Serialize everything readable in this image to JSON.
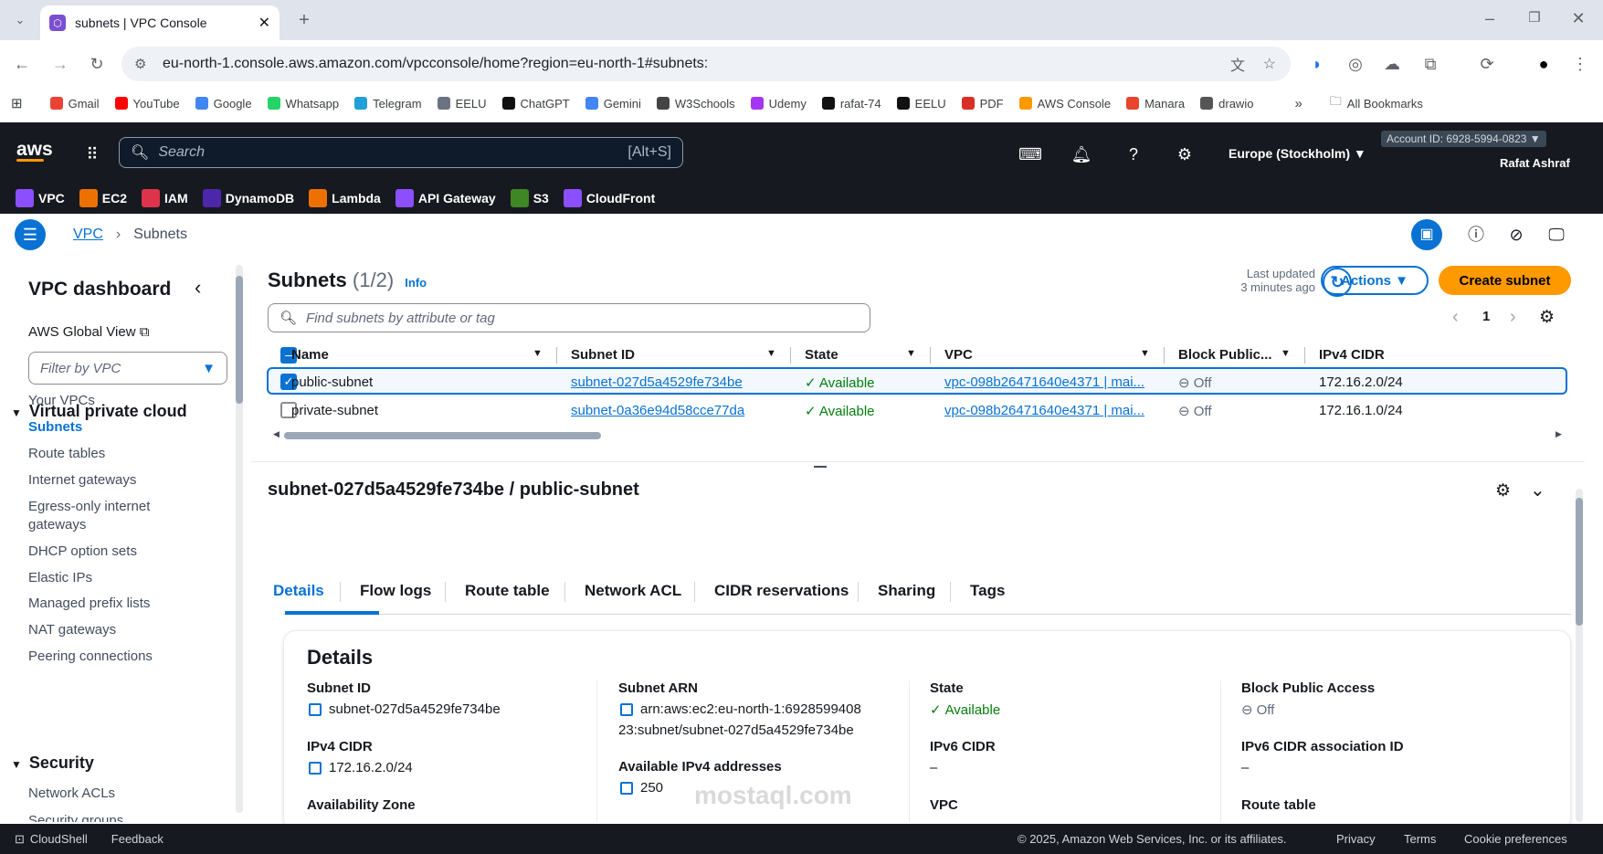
{
  "browser": {
    "tab_title": "subnets | VPC Console",
    "url": "eu-north-1.console.aws.amazon.com/vpcconsole/home?region=eu-north-1#subnets:",
    "bookmarks": [
      "Gmail",
      "YouTube",
      "Google",
      "Whatsapp",
      "Telegram",
      "EELU",
      "ChatGPT",
      "Gemini",
      "W3Schools",
      "Udemy",
      "rafat-74",
      "EELU",
      "PDF",
      "AWS Console",
      "Manara",
      "drawio"
    ],
    "all_bookmarks": "All Bookmarks",
    "colors": {
      "gmail": "#ea4335",
      "youtube": "#ff0000",
      "google": "#4285f4",
      "whatsapp": "#25d366",
      "telegram": "#229ed9",
      "udemy": "#a435f0",
      "aws": "#ff9900"
    }
  },
  "aws": {
    "search_placeholder": "Search",
    "search_shortcut": "[Alt+S]",
    "region": "Europe (Stockholm) ▼",
    "account": "Account ID: 6928-5994-0823 ▼",
    "user": "Rafat Ashraf",
    "services": [
      {
        "label": "VPC",
        "color": "#8c4fff"
      },
      {
        "label": "EC2",
        "color": "#ed7100"
      },
      {
        "label": "IAM",
        "color": "#dd344c"
      },
      {
        "label": "DynamoDB",
        "color": "#4d27aa"
      },
      {
        "label": "Lambda",
        "color": "#ed7100"
      },
      {
        "label": "API Gateway",
        "color": "#8c4fff"
      },
      {
        "label": "S3",
        "color": "#3f8624"
      },
      {
        "label": "CloudFront",
        "color": "#8c4fff"
      }
    ]
  },
  "breadcrumb": {
    "root": "VPC",
    "current": "Subnets"
  },
  "sidebar": {
    "title": "VPC dashboard",
    "global_view": "AWS Global View",
    "filter_placeholder": "Filter by VPC",
    "section1": "Virtual private cloud",
    "items": [
      "Your VPCs",
      "Subnets",
      "Route tables",
      "Internet gateways",
      "Egress-only internet",
      "gateways",
      "DHCP option sets",
      "Elastic IPs",
      "Managed prefix lists",
      "NAT gateways",
      "Peering connections"
    ],
    "section2": "Security",
    "items2": [
      "Network ACLs",
      "Security groups"
    ]
  },
  "main": {
    "title": "Subnets",
    "count": "(1/2)",
    "info": "Info",
    "last_updated": "Last updated",
    "updated_ago": "3 minutes ago",
    "actions": "Actions ▼",
    "create": "Create subnet",
    "filter_placeholder": "Find subnets by attribute or tag",
    "page": "1",
    "columns": [
      "Name",
      "Subnet ID",
      "State",
      "VPC",
      "Block Public...",
      "IPv4 CIDR"
    ],
    "rows": [
      {
        "name": "public-subnet",
        "id": "subnet-027d5a4529fe734be",
        "state": "Available",
        "vpc": "vpc-098b26471640e4371 | mai...",
        "block": "Off",
        "cidr": "172.16.2.0/24",
        "selected": true
      },
      {
        "name": "private-subnet",
        "id": "subnet-0a36e94d58cce77da",
        "state": "Available",
        "vpc": "vpc-098b26471640e4371 | mai...",
        "block": "Off",
        "cidr": "172.16.1.0/24",
        "selected": false
      }
    ]
  },
  "detail": {
    "heading": "subnet-027d5a4529fe734be / public-subnet",
    "tabs": [
      "Details",
      "Flow logs",
      "Route table",
      "Network ACL",
      "CIDR reservations",
      "Sharing",
      "Tags"
    ],
    "section": "Details",
    "fields": {
      "subnet_id_label": "Subnet ID",
      "subnet_id": "subnet-027d5a4529fe734be",
      "arn_label": "Subnet ARN",
      "arn1": "arn:aws:ec2:eu-north-1:6928599408",
      "arn2": "23:subnet/subnet-027d5a4529fe734be",
      "state_label": "State",
      "state": "Available",
      "bpa_label": "Block Public Access",
      "bpa": "Off",
      "ipv4_label": "IPv4 CIDR",
      "ipv4": "172.16.2.0/24",
      "avail_label": "Available IPv4 addresses",
      "avail": "250",
      "ipv6_label": "IPv6 CIDR",
      "ipv6": "–",
      "ipv6assoc_label": "IPv6 CIDR association ID",
      "ipv6assoc": "–",
      "az_label": "Availability Zone",
      "vpc_label": "VPC",
      "rt_label": "Route table"
    }
  },
  "footer": {
    "cloudshell": "CloudShell",
    "feedback": "Feedback",
    "copyright": "© 2025, Amazon Web Services, Inc. or its affiliates.",
    "privacy": "Privacy",
    "terms": "Terms",
    "cookies": "Cookie preferences"
  },
  "watermark": {
    "text": "mostaql.com"
  }
}
